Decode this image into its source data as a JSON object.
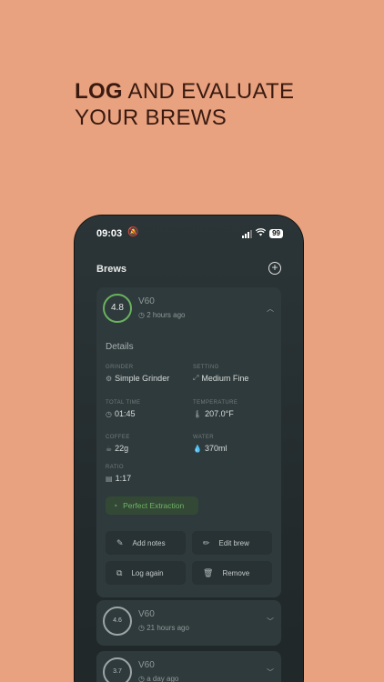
{
  "headline": {
    "bold": "LOG",
    "line1_rest": " AND EVALUATE",
    "line2": "YOUR BREWS"
  },
  "status": {
    "time": "09:03",
    "battery": "99"
  },
  "header": {
    "title": "Brews",
    "add_icon": "plus-circle-icon"
  },
  "brews": [
    {
      "rating": "4.8",
      "method": "V60",
      "ago": "2 hours ago",
      "expanded": true
    },
    {
      "rating": "4.6",
      "method": "V60",
      "ago": "21 hours ago",
      "expanded": false
    },
    {
      "rating": "3.7",
      "method": "V60",
      "ago": "a day ago",
      "expanded": false
    }
  ],
  "details": {
    "heading": "Details",
    "grinder_label": "GRINDER",
    "grinder": "Simple Grinder",
    "setting_label": "SETTING",
    "setting": "Medium Fine",
    "total_time_label": "TOTAL TIME",
    "total_time": "01:45",
    "temperature_label": "TEMPERATURE",
    "temperature": "207.0°F",
    "coffee_label": "COFFEE",
    "coffee": "22g",
    "water_label": "WATER",
    "water": "370ml",
    "ratio_label": "RATIO",
    "ratio": "1:17"
  },
  "badge": "Perfect Extraction",
  "actions": {
    "add_notes": "Add notes",
    "edit_brew": "Edit brew",
    "log_again": "Log again",
    "remove": "Remove"
  },
  "colors": {
    "background": "#e8a27f",
    "accent_green": "#69b25e",
    "card": "#2f3a3c"
  }
}
